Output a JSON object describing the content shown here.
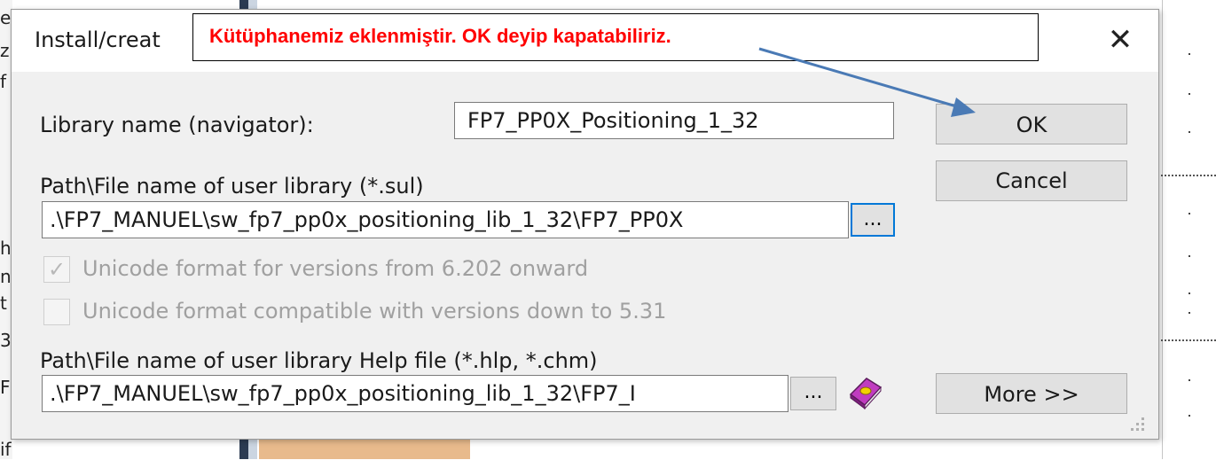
{
  "dialog": {
    "title": "Install/creat",
    "close_glyph": "✕",
    "library_name_label": "Library name (navigator):",
    "library_name_value": "FP7_PP0X_Positioning_1_32",
    "ok_label": "OK",
    "cancel_label": "Cancel",
    "path_label": "Path\\File name of user library (*.sul)",
    "path_value": ".\\FP7_MANUEL\\sw_fp7_pp0x_positioning_lib_1_32\\FP7_PP0X",
    "browse_label": "...",
    "unicode_format_label": "Unicode format for versions from 6.202 onward",
    "unicode_format_checked": true,
    "unicode_compat_label": "Unicode format compatible with versions down to 5.31",
    "unicode_compat_checked": false,
    "help_path_label": "Path\\File name of user library Help file (*.hlp, *.chm)",
    "help_path_value": ".\\FP7_MANUEL\\sw_fp7_pp0x_positioning_lib_1_32\\FP7_I",
    "help_browse_label": "...",
    "more_label": "More >>",
    "help_icon": "help-book-icon"
  },
  "annotation": {
    "text": "Kütüphanemiz eklenmiştir. OK deyip kapatabiliriz.",
    "color": "#ff0000",
    "arrow_color": "#4a7ab5"
  },
  "background": {
    "left_glyphs": [
      "e",
      "z",
      "f",
      "n",
      "h",
      "3",
      "t",
      "F",
      "if"
    ]
  }
}
